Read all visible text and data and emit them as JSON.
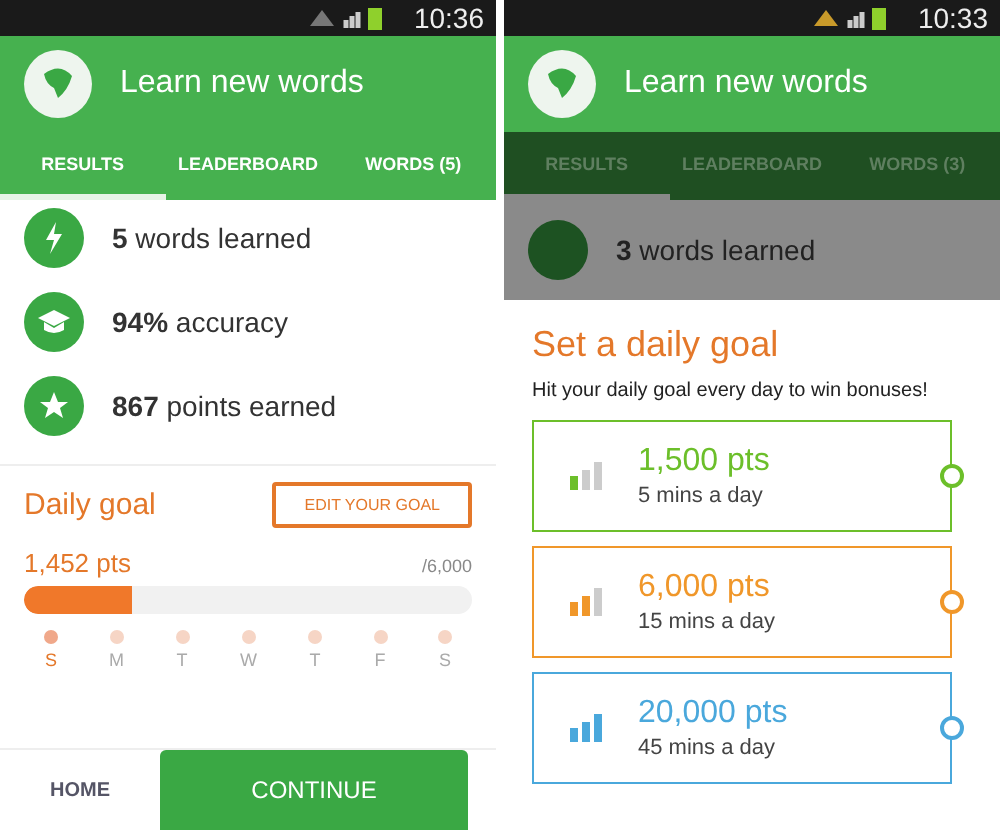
{
  "left_screen": {
    "status_time": "10:36",
    "title": "Learn new words",
    "tabs": [
      {
        "label": "RESULTS",
        "selected": true
      },
      {
        "label": "LEADERBOARD",
        "selected": false
      },
      {
        "label": "WORDS (5)",
        "selected": false
      }
    ],
    "stats": [
      {
        "kind": "bolt",
        "value": "5",
        "label": "words learned"
      },
      {
        "kind": "cap",
        "value": "94%",
        "label": "accuracy"
      },
      {
        "kind": "star",
        "value": "867",
        "label": "points earned"
      }
    ],
    "daily_goal": {
      "title": "Daily goal",
      "button": "EDIT YOUR GOAL",
      "points": "1,452 pts",
      "total": "/6,000",
      "level": 0.242,
      "days": [
        {
          "letter": "S",
          "active": true
        },
        {
          "letter": "M",
          "active": false
        },
        {
          "letter": "T",
          "active": false
        },
        {
          "letter": "W",
          "active": false
        },
        {
          "letter": "T",
          "active": false
        },
        {
          "letter": "F",
          "active": false
        },
        {
          "letter": "S",
          "active": false
        }
      ]
    },
    "bottom_bar": {
      "home": "HOME",
      "continue": "CONTINUE"
    }
  },
  "right_screen": {
    "status_time": "10:33",
    "title": "Learn new words",
    "tabs": [
      {
        "label": "RESULTS",
        "selected": true
      },
      {
        "label": "LEADERBOARD",
        "selected": false
      },
      {
        "label": "WORDS (3)",
        "selected": false
      }
    ],
    "background_stat": {
      "value": "3",
      "label": "words learned"
    },
    "dialog": {
      "title": "Set a daily goal",
      "subtitle": "Hit your daily goal every day to win bonuses!",
      "options": [
        {
          "points": "1,500 pts",
          "time": "5 mins a day",
          "kind": "low",
          "color": "#6cbf2a",
          "selected": false
        },
        {
          "points": "6,000 pts",
          "time": "15 mins a day",
          "kind": "medium",
          "color": "#f0972a",
          "selected": false
        },
        {
          "points": "20,000 pts",
          "time": "45 mins a day",
          "kind": "high",
          "color": "#4aa8dc",
          "selected": false
        }
      ]
    }
  }
}
